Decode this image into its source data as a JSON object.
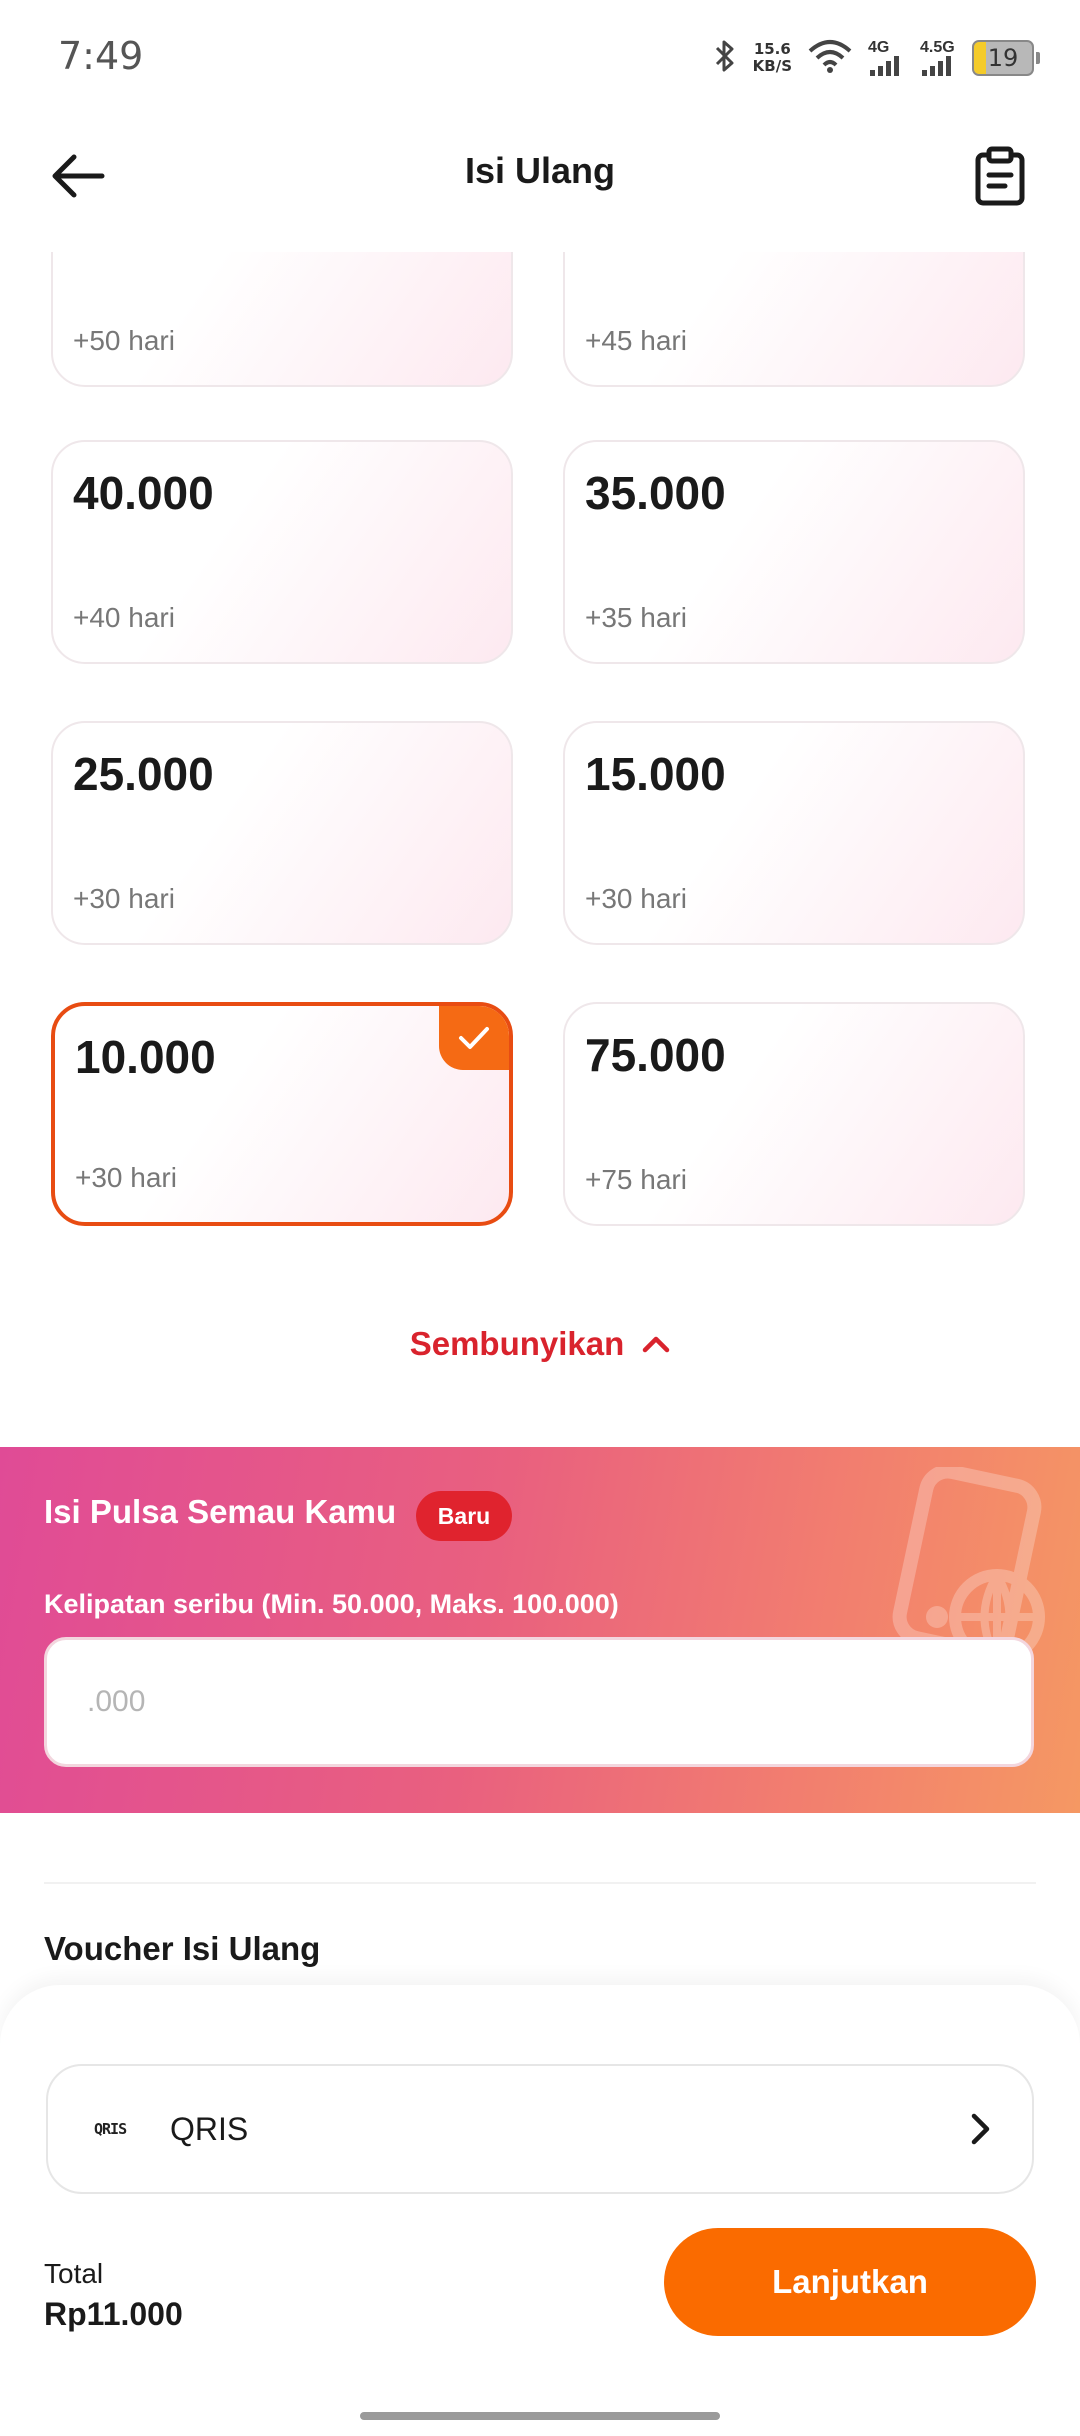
{
  "status_bar": {
    "time": "7:49",
    "net_speed_value": "15.6",
    "net_speed_unit": "KB/S",
    "signal1_label": "4G",
    "signal2_label": "4.5G",
    "battery": "19"
  },
  "header": {
    "title": "Isi Ulang",
    "back_icon": "arrow-left-icon",
    "history_icon": "clipboard-icon"
  },
  "nominal_cards": [
    {
      "amount": "",
      "days": "+50 hari",
      "selected": false
    },
    {
      "amount": "",
      "days": "+45 hari",
      "selected": false
    },
    {
      "amount": "40.000",
      "days": "+40 hari",
      "selected": false
    },
    {
      "amount": "35.000",
      "days": "+35 hari",
      "selected": false
    },
    {
      "amount": "25.000",
      "days": "+30 hari",
      "selected": false
    },
    {
      "amount": "15.000",
      "days": "+30 hari",
      "selected": false
    },
    {
      "amount": "10.000",
      "days": "+30 hari",
      "selected": true
    },
    {
      "amount": "75.000",
      "days": "+75 hari",
      "selected": false
    }
  ],
  "collapse": {
    "label": "Sembunyikan",
    "icon": "chevron-up-icon"
  },
  "promo": {
    "title": "Isi Pulsa Semau Kamu",
    "badge": "Baru",
    "subtitle": "Kelipatan seribu (Min. 50.000, Maks. 100.000)",
    "input_placeholder": ".000",
    "input_value": ""
  },
  "voucher": {
    "title": "Voucher Isi Ulang"
  },
  "payment": {
    "logo": "QRIS",
    "method": "QRIS",
    "icon": "chevron-right-icon"
  },
  "footer": {
    "total_label": "Total",
    "total_value": "Rp11.000",
    "button_label": "Lanjutkan"
  },
  "colors": {
    "accent": "#fa6b00",
    "selected_border": "#e84c12",
    "collapse_text": "#d9232d",
    "badge_red": "#e0232e"
  }
}
